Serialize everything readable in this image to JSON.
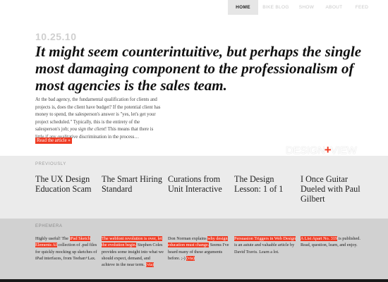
{
  "nav": {
    "items": [
      {
        "label": "HOME",
        "active": true
      },
      {
        "label": "BIKE BLOG",
        "active": false
      },
      {
        "label": "SHOW",
        "active": false
      },
      {
        "label": "ABOUT",
        "active": false
      },
      {
        "label": "FEED",
        "active": false
      }
    ]
  },
  "post": {
    "date": "10.25.10",
    "headline": "It might seem counterintuitive, but perhaps the single most damaging component to the professionalism of most agencies is the sales team.",
    "body_part1": "At the bad agency, the fundamental qualification for clients and projects is, does the client have budget? If the potential client has money to spend, the salesperson's answer is \"yes, let's get your project scheduled.\" Typically, this is the entirety of the salesperson's job; ",
    "body_italic": "you sign the client",
    "body_part2": "! This means that there is little if any qualitative discrimination in the process…",
    "read_more": "Read the article »"
  },
  "logo": {
    "left": "DESIGN",
    "plus": "+",
    "right": "VIEW"
  },
  "previously": {
    "label": "PREVIOUSLY",
    "items": [
      "The UX Design Education Scam",
      "The Smart Hiring Standard",
      "Curations from Unit Interactive",
      "The Design Lesson: 1 of 1",
      "I Once Guitar Dueled with Paul Gilbert"
    ]
  },
  "ephemera": {
    "label": "EPHEMERA",
    "items": [
      {
        "pre": "Highly useful! The ",
        "hl": "iPad Sketch Elements AI",
        "post": " collection of .psd files for quickly mocking up sketches of iPad interfaces, from Teehan+Lax.",
        "hl2": ""
      },
      {
        "pre": "",
        "hl": "The webfont revolution is over, let the evolution begin.",
        "post": " Stephen Coles provides some insight into what we should expect, demand, and achieve in the near term. ",
        "hl2": "(via)"
      },
      {
        "pre": "Don Norman explains ",
        "hl": "why design education must change.",
        "post": " Seems I've heard many of these arguments before. ;-) ",
        "hl2": "(via)"
      },
      {
        "pre": "",
        "hl": "Persuasion Triggers in Web Design",
        "post": " is an astute and valuable article by David Travis. Learn a lot.",
        "hl2": ""
      },
      {
        "pre": "",
        "hl": "A List Apart No. 319",
        "post": " is published. Read, question, learn, and enjoy.",
        "hl2": ""
      }
    ]
  }
}
